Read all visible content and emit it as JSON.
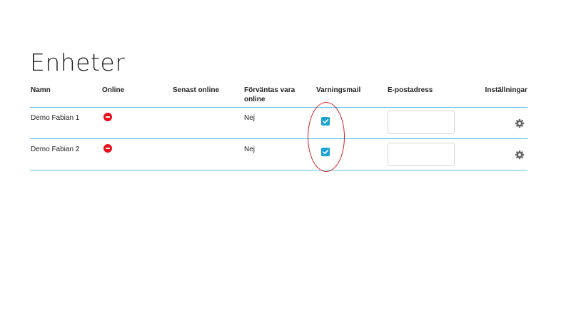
{
  "page": {
    "title": "Enheter"
  },
  "table": {
    "headers": {
      "name": "Namn",
      "online": "Online",
      "last_online": "Senast online",
      "expected_online": "Förväntas vara online",
      "warning_mail": "Varningsmail",
      "email": "E-postadress",
      "settings": "Inställningar"
    },
    "rows": [
      {
        "name": "Demo Fabian 1",
        "online_status": "offline",
        "last_online": "",
        "expected_online": "Nej",
        "warning_mail_checked": true,
        "email": ""
      },
      {
        "name": "Demo Fabian 2",
        "online_status": "offline",
        "last_online": "",
        "expected_online": "Nej",
        "warning_mail_checked": true,
        "email": ""
      }
    ]
  },
  "icons": {
    "status": "minus-circle-icon",
    "checkbox": "check-icon",
    "settings": "gear-icon"
  },
  "colors": {
    "accent": "#1aa3d4",
    "row_divider": "#5bc0de",
    "offline_status": "#e8101b",
    "annotation": "#d42020",
    "gear": "#666666"
  }
}
